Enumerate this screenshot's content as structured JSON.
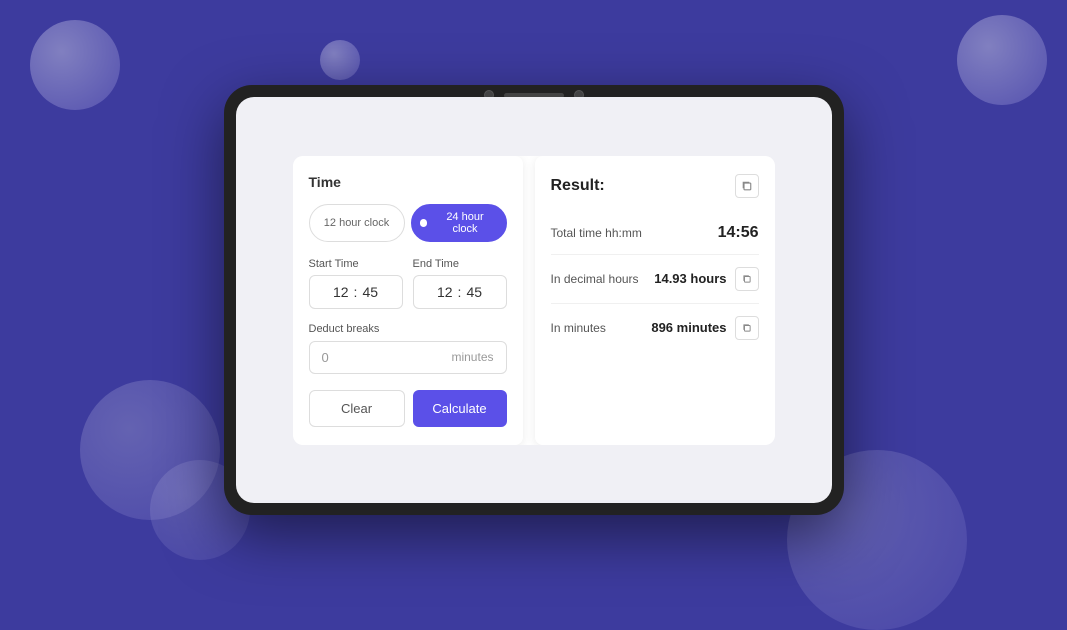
{
  "background": {
    "color": "#3d3b9e"
  },
  "tablet": {
    "app": {
      "left_panel": {
        "title": "Time",
        "clock_toggle": {
          "option_12h": "12 hour clock",
          "option_24h": "24 hour clock",
          "active": "24h"
        },
        "start_time": {
          "label": "Start Time",
          "hours": "12",
          "minutes": "45"
        },
        "end_time": {
          "label": "End Time",
          "hours": "12",
          "minutes": "45"
        },
        "deduct_breaks": {
          "label": "Deduct breaks",
          "value": "0",
          "unit": "minutes"
        },
        "buttons": {
          "clear": "Clear",
          "calculate": "Calculate"
        }
      },
      "right_panel": {
        "title": "Result:",
        "total_time": {
          "label": "Total time hh:mm",
          "value": "14:56"
        },
        "decimal_hours": {
          "label": "In decimal hours",
          "value": "14.93 hours"
        },
        "minutes": {
          "label": "In minutes",
          "value": "896 minutes"
        }
      }
    }
  }
}
